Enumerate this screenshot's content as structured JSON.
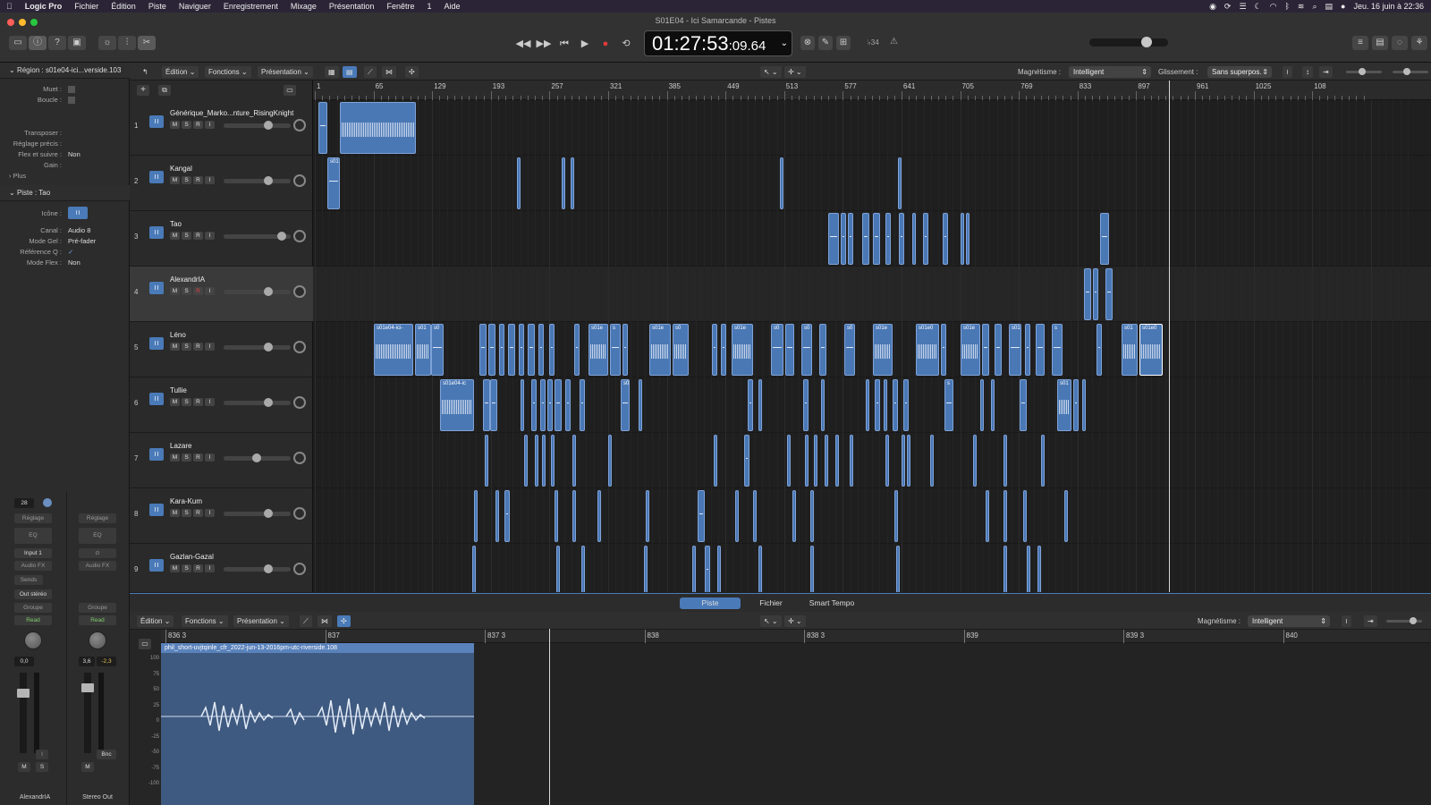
{
  "menubar": {
    "apple": "",
    "items": [
      "Logic Pro",
      "Fichier",
      "Édition",
      "Piste",
      "Naviguer",
      "Enregistrement",
      "Mixage",
      "Présentation",
      "Fenêtre",
      "1",
      "Aide"
    ],
    "clock": "Jeu. 16 juin à 22:36"
  },
  "window": {
    "title": "S01E04 - Ici Samarcande - Pistes",
    "lcd_main": "01:27:53",
    "lcd_sub": ":09.64",
    "key": "♭34"
  },
  "inspector": {
    "region_title": "Région : s01e04-ici...verside.103",
    "region_rows": [
      {
        "label": "Muet :",
        "value": ""
      },
      {
        "label": "Boucle :",
        "value": ""
      },
      {
        "label": "Transposer :",
        "value": ""
      },
      {
        "label": "Réglage précis :",
        "value": ""
      },
      {
        "label": "Flex et suivre :",
        "value": "Non"
      },
      {
        "label": "Gain :",
        "value": ""
      }
    ],
    "plus": "Plus",
    "track_title": "Piste : Tao",
    "track_rows": [
      {
        "label": "Icône :",
        "value": ""
      },
      {
        "label": "Canal :",
        "value": "Audio 8"
      },
      {
        "label": "Mode Gel :",
        "value": "Pré-fader"
      },
      {
        "label": "Référence Q :",
        "value": "✓"
      },
      {
        "label": "Mode Flex :",
        "value": "Non"
      }
    ],
    "strip1": {
      "value": "28",
      "setting": "Réglage",
      "eq": "EQ",
      "input": "Input 1",
      "fx": "Audio FX",
      "sends": "Sends",
      "out": "Out stéréo",
      "group": "Groupe",
      "auto": "Read",
      "vol": "0,0",
      "name": "AlexandrIA",
      "m": "M",
      "s": "S"
    },
    "strip2": {
      "setting": "Réglage",
      "eq": "EQ",
      "fx": "Audio FX",
      "group": "Groupe",
      "auto": "Read",
      "vol": "3,6",
      "peak": "-2,3",
      "name": "Stereo Out",
      "m": "M",
      "bnc": "Bnc"
    }
  },
  "toolbar": {
    "edition": "Édition",
    "fonctions": "Fonctions",
    "presentation": "Présentation",
    "magnet_label": "Magnétisme :",
    "magnet_value": "Intelligent",
    "slide_label": "Glissement :",
    "slide_value": "Sans superpos."
  },
  "ruler": [
    "1",
    "65",
    "129",
    "193",
    "257",
    "321",
    "385",
    "449",
    "513",
    "577",
    "641",
    "705",
    "769",
    "833",
    "897",
    "961",
    "1025",
    "108"
  ],
  "tracks": [
    {
      "num": "1",
      "name": "Générique_Marko...nture_RisingKnight"
    },
    {
      "num": "2",
      "name": "Kangal"
    },
    {
      "num": "3",
      "name": "Tao"
    },
    {
      "num": "4",
      "name": "AlexandrIA"
    },
    {
      "num": "5",
      "name": "Léno"
    },
    {
      "num": "6",
      "name": "Tullie"
    },
    {
      "num": "7",
      "name": "Lazare"
    },
    {
      "num": "8",
      "name": "Kara-Kum"
    },
    {
      "num": "9",
      "name": "Gazlan-Gazal"
    }
  ],
  "btn": {
    "m": "M",
    "s": "S",
    "r": "R",
    "i": "I"
  },
  "region_labels": {
    "r2": "s01",
    "r5a": "s01e04-ici-",
    "r5b": "s01",
    "r5c": "s0",
    "r5d": "s01e",
    "r5e": "s",
    "r5f": "s01e",
    "r5g": "s0",
    "r5h": "s01e",
    "r5i": "s0",
    "r5j": "s0",
    "r5k": "s0",
    "r5l": "s01e",
    "r5m": "s01e0",
    "r5n": "s01e",
    "r5o": "s01",
    "r5p": "s",
    "r5q": "s01",
    "r5r": "s01e0",
    "r6a": "s01e04-ic",
    "r6b": "s0",
    "r6c": "s",
    "r6d": "s01"
  },
  "editor": {
    "tabs": [
      "Piste",
      "Fichier",
      "Smart Tempo"
    ],
    "edition": "Édition",
    "fonctions": "Fonctions",
    "presentation": "Présentation",
    "magnet_label": "Magnétisme :",
    "magnet_value": "Intelligent",
    "ruler": [
      "836 3",
      "837",
      "837 3",
      "838",
      "838 3",
      "839",
      "839 3",
      "840"
    ],
    "region_name": "phil_short-uvjtqinle_cfr_2022-jun-13-2016pm-utc-riverside.108",
    "yaxis": [
      "100",
      "75",
      "50",
      "25",
      "0",
      "-25",
      "-50",
      "-75",
      "-100"
    ]
  }
}
